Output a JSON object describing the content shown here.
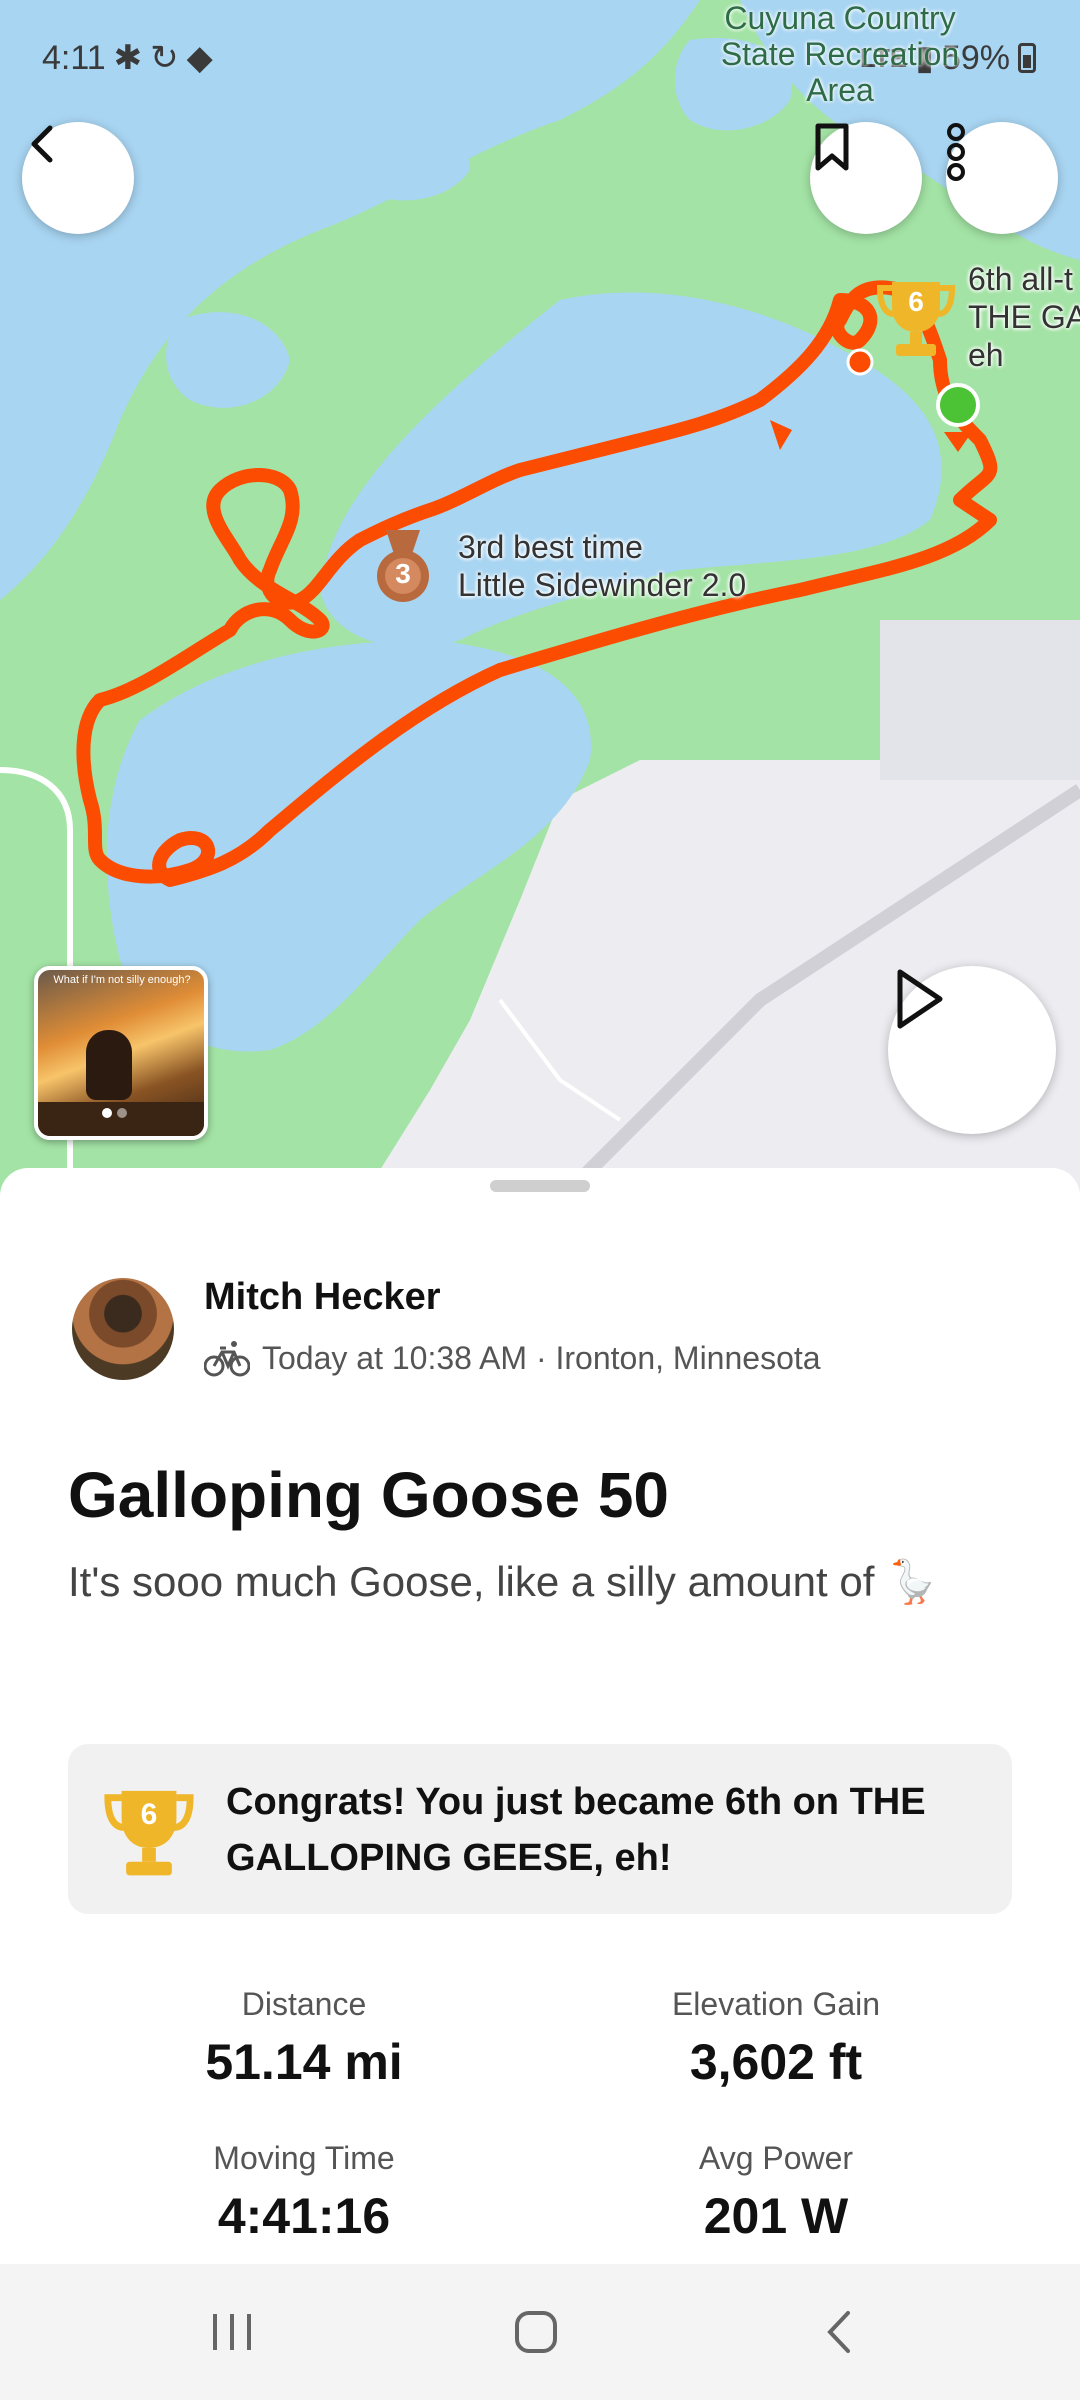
{
  "status_bar": {
    "time": "4:11",
    "battery": "59%"
  },
  "map": {
    "park_label": "Cuyuna Country State Recreation Area",
    "segment_best": {
      "rank": "3",
      "line1": "3rd best time",
      "line2": "Little Sidewinder 2.0"
    },
    "segment_alltime": {
      "rank": "6",
      "line1": "6th all-t",
      "line2": "THE GA",
      "line3": "eh"
    },
    "photo_caption": "What if I'm not silly enough?"
  },
  "activity": {
    "athlete": "Mitch Hecker",
    "meta": "Today at 10:38 AM · Ironton, Minnesota",
    "title": "Galloping Goose 50",
    "description": "It's sooo much Goose, like a silly amount of 🪿",
    "achievement": {
      "rank": "6",
      "text": "Congrats! You just became 6th on THE GALLOPING GEESE, eh!"
    },
    "stats": [
      {
        "label": "Distance",
        "value": "51.14 mi"
      },
      {
        "label": "Elevation Gain",
        "value": "3,602 ft"
      },
      {
        "label": "Moving Time",
        "value": "4:41:16"
      },
      {
        "label": "Avg Power",
        "value": "201 W"
      }
    ]
  },
  "colors": {
    "route": "#fc4c02",
    "water": "#a8d5f2",
    "park": "#a3e3a5",
    "land": "#ececf1",
    "gold": "#f0b62a",
    "bronze": "#b86a3e"
  }
}
